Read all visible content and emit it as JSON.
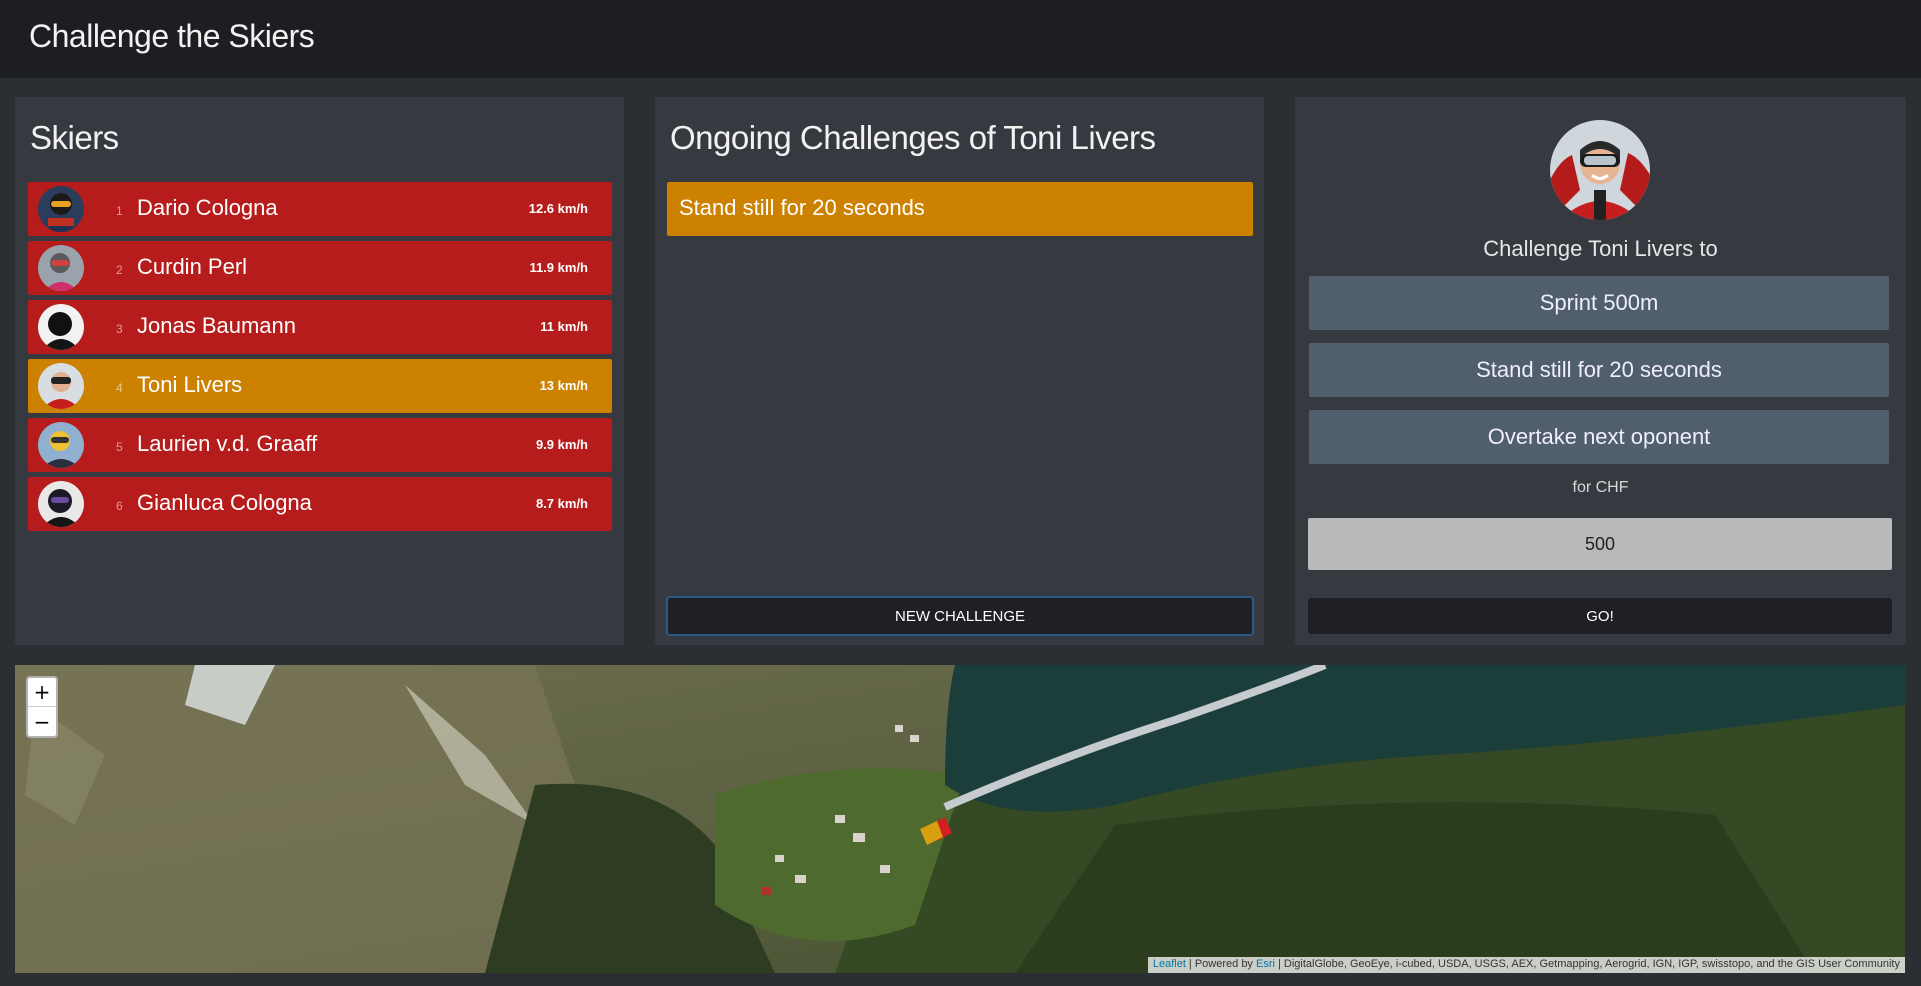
{
  "app": {
    "title": "Challenge the Skiers"
  },
  "skiers_panel": {
    "title": "Skiers",
    "items": [
      {
        "rank": "1",
        "name": "Dario Cologna",
        "speed": "12.6 km/h",
        "active": false
      },
      {
        "rank": "2",
        "name": "Curdin Perl",
        "speed": "11.9 km/h",
        "active": false
      },
      {
        "rank": "3",
        "name": "Jonas Baumann",
        "speed": "11 km/h",
        "active": false
      },
      {
        "rank": "4",
        "name": "Toni Livers",
        "speed": "13 km/h",
        "active": true
      },
      {
        "rank": "5",
        "name": "Laurien v.d. Graaff",
        "speed": "9.9 km/h",
        "active": false
      },
      {
        "rank": "6",
        "name": "Gianluca Cologna",
        "speed": "8.7 km/h",
        "active": false
      }
    ]
  },
  "ongoing_panel": {
    "title": "Ongoing Challenges of Toni Livers",
    "challenges": [
      "Stand still for 20 seconds"
    ],
    "new_button": "NEW CHALLENGE"
  },
  "challenge_panel": {
    "prompt": "Challenge Toni Livers to",
    "options": [
      "Sprint 500m",
      "Stand still for 20 seconds",
      "Overtake next oponent"
    ],
    "currency_label": "for CHF",
    "amount": "500",
    "go_button": "GO!"
  },
  "map": {
    "zoom_in": "+",
    "zoom_out": "−",
    "attribution": {
      "leaflet": "Leaflet",
      "powered_by": " | Powered by ",
      "esri": "Esri",
      "sources": " | DigitalGlobe, GeoEye, i-cubed, USDA, USGS, AEX, Getmapping, Aerogrid, IGN, IGP, swisstopo, and the GIS User Community"
    }
  },
  "colors": {
    "skier_default": "#b71c1c",
    "skier_active": "#cc8100",
    "option_button": "#515e6e"
  }
}
